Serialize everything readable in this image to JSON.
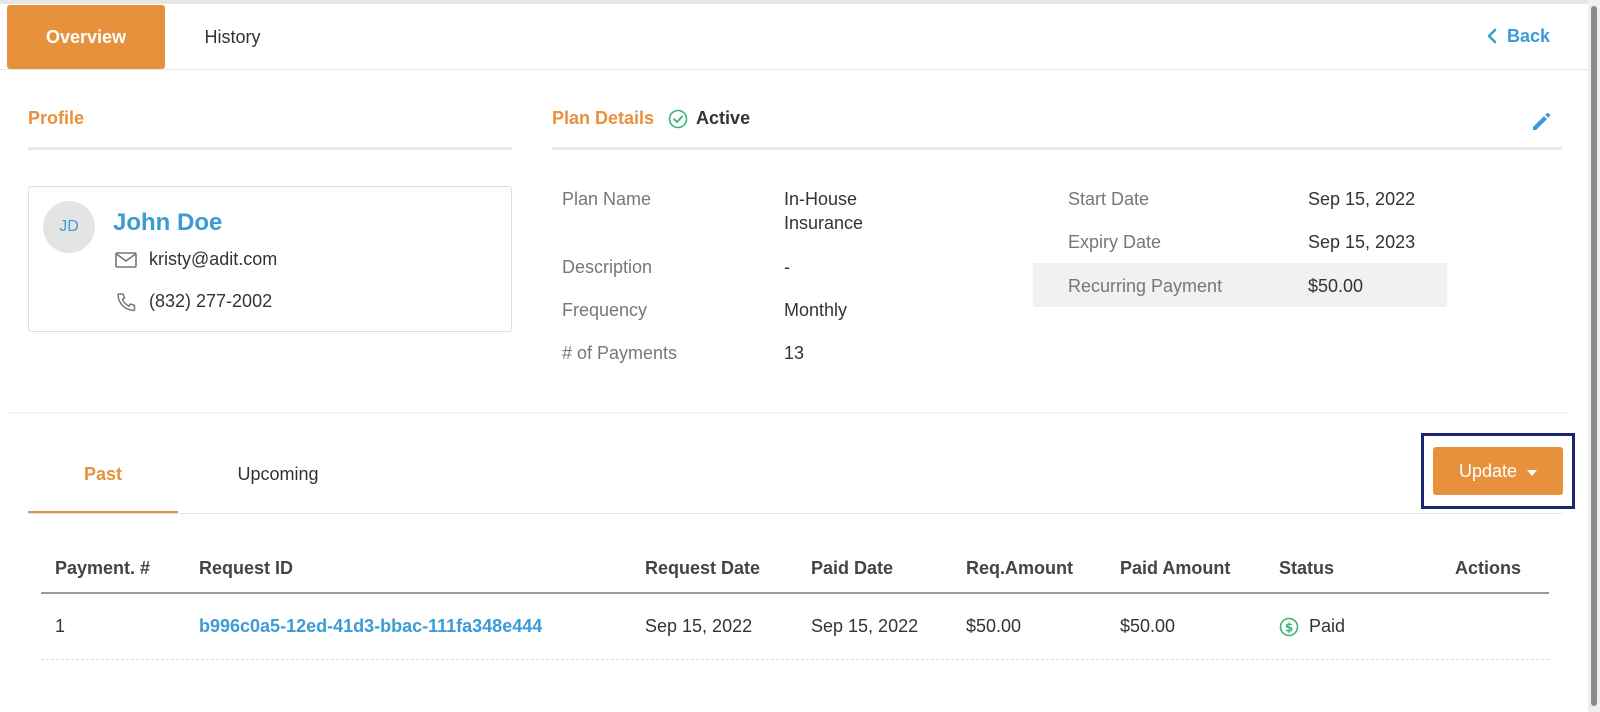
{
  "tabs": {
    "overview": "Overview",
    "history": "History",
    "back": "Back"
  },
  "profile": {
    "title": "Profile",
    "initials": "JD",
    "name": "John Doe",
    "email": "kristy@adit.com",
    "phone": "(832) 277-2002"
  },
  "plan": {
    "title": "Plan Details",
    "status": "Active",
    "left": [
      {
        "label": "Plan Name",
        "value": "In-House Insurance"
      },
      {
        "label": "Description",
        "value": "-"
      },
      {
        "label": "Frequency",
        "value": "Monthly"
      },
      {
        "label": "# of Payments",
        "value": "13"
      }
    ],
    "right": [
      {
        "label": "Start Date",
        "value": "Sep 15, 2022"
      },
      {
        "label": "Expiry Date",
        "value": "Sep 15, 2023"
      },
      {
        "label": "Recurring Payment",
        "value": "$50.00"
      }
    ]
  },
  "payments": {
    "tabs": {
      "past": "Past",
      "upcoming": "Upcoming"
    },
    "update_label": "Update",
    "headers": [
      "Payment. #",
      "Request ID",
      "Request Date",
      "Paid Date",
      "Req.Amount",
      "Paid Amount",
      "Status",
      "Actions"
    ],
    "rows": [
      {
        "number": "1",
        "request_id": "b996c0a5-12ed-41d3-bbac-111fa348e444",
        "request_date": "Sep 15, 2022",
        "paid_date": "Sep 15, 2022",
        "req_amount": "$50.00",
        "paid_amount": "$50.00",
        "status": "Paid"
      }
    ]
  },
  "colors": {
    "accent": "#e8913d",
    "link": "#3a9bd5",
    "success": "#3cb371",
    "focus": "#1a2470"
  }
}
